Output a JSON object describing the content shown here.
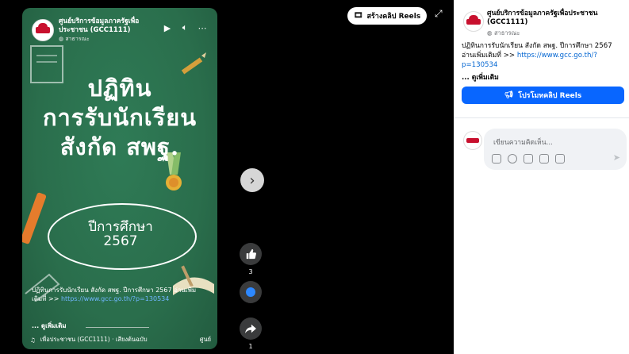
{
  "reel": {
    "page_name": "ศูนย์บริการข้อมูลภาครัฐเพื่อประชาชน (GCC1111)",
    "privacy": "สาธารณะ",
    "line1": "ปฏิทิน",
    "line2": "การรับนักเรียน",
    "line3": "สังกัด สพฐ.",
    "year_label": "ปีการศึกษา",
    "year_value": "2567",
    "caption_text": "ปฏิทินการรับนักเรียน สังกัด สพฐ. ปีการศึกษา 2567 อ่านเพิ่มเติมที่ >> ",
    "caption_link": "https://www.gcc.go.th/?p=130534",
    "see_more": "... ดูเพิ่มเติม",
    "audio_text": "เพื่อประชาชน (GCC1111) · เสียงต้นฉบับ",
    "audio_tail": "ศูนย์"
  },
  "actions": {
    "like_count": "3",
    "share_count": "1"
  },
  "toolbar": {
    "create_reels": "สร้างคลิป Reels"
  },
  "panel": {
    "page_name": "ศูนย์บริการข้อมูลภาครัฐเพื่อประชาชน (GCC1111)",
    "privacy": "สาธารณะ",
    "caption_text": "ปฏิทินการรับนักเรียน สังกัด สพฐ. ปีการศึกษา 2567 อ่านเพิ่มเติมที่ >> ",
    "caption_link": "https://www.gcc.go.th/?p=130534",
    "see_more": "... ดูเพิ่มเติม",
    "promote_label": "โปรโมทคลิป Reels",
    "comment_placeholder": "เขียนความคิดเห็น..."
  },
  "colors": {
    "accent": "#0866ff",
    "board": "#2a6e4c"
  }
}
